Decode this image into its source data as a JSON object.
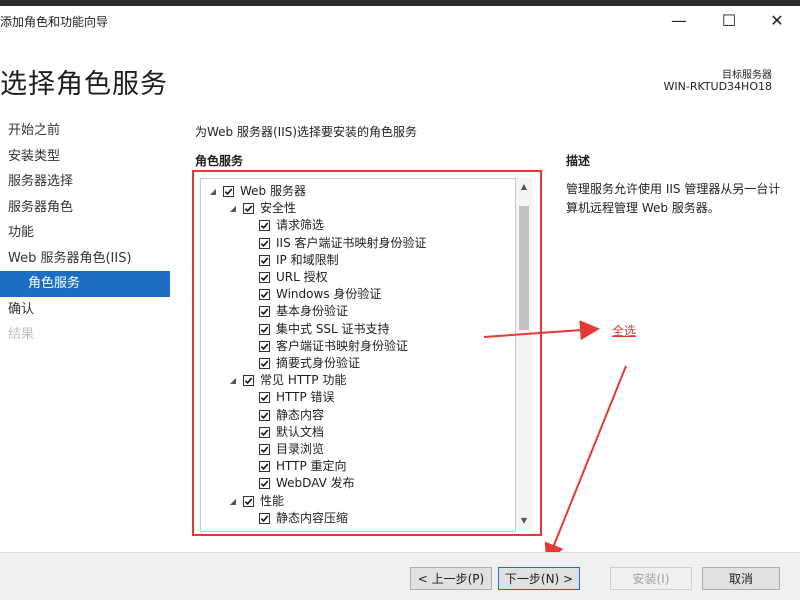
{
  "window": {
    "title": "添加角色和功能向导",
    "controls": {
      "minimize": "—",
      "maximize": "☐",
      "close": "✕"
    }
  },
  "header": {
    "page_title": "选择角色服务",
    "server_label": "目标服务器",
    "server_name": "WIN-RKTUD34HO18"
  },
  "nav": {
    "items": [
      {
        "label": "开始之前",
        "state": "normal"
      },
      {
        "label": "安装类型",
        "state": "normal"
      },
      {
        "label": "服务器选择",
        "state": "normal"
      },
      {
        "label": "服务器角色",
        "state": "normal"
      },
      {
        "label": "功能",
        "state": "normal"
      },
      {
        "label": "Web 服务器角色(IIS)",
        "state": "normal"
      },
      {
        "label": "角色服务",
        "state": "active"
      },
      {
        "label": "确认",
        "state": "normal"
      },
      {
        "label": "结果",
        "state": "disabled"
      }
    ]
  },
  "main": {
    "instruction": "为Web 服务器(IIS)选择要安装的角色服务",
    "section_title": "角色服务",
    "tree": [
      {
        "label": "Web 服务器",
        "level": 0,
        "expander": "◢",
        "checked": true
      },
      {
        "label": "安全性",
        "level": 1,
        "expander": "◢",
        "checked": true
      },
      {
        "label": "请求筛选",
        "level": 2,
        "checked": true
      },
      {
        "label": "IIS 客户端证书映射身份验证",
        "level": 2,
        "checked": true
      },
      {
        "label": "IP 和域限制",
        "level": 2,
        "checked": true
      },
      {
        "label": "URL 授权",
        "level": 2,
        "checked": true
      },
      {
        "label": "Windows 身份验证",
        "level": 2,
        "checked": true
      },
      {
        "label": "基本身份验证",
        "level": 2,
        "checked": true
      },
      {
        "label": "集中式 SSL 证书支持",
        "level": 2,
        "checked": true
      },
      {
        "label": "客户端证书映射身份验证",
        "level": 2,
        "checked": true
      },
      {
        "label": "摘要式身份验证",
        "level": 2,
        "checked": true
      },
      {
        "label": "常见 HTTP 功能",
        "level": 1,
        "expander": "◢",
        "checked": true
      },
      {
        "label": "HTTP 错误",
        "level": 2,
        "checked": true
      },
      {
        "label": "静态内容",
        "level": 2,
        "checked": true
      },
      {
        "label": "默认文档",
        "level": 2,
        "checked": true
      },
      {
        "label": "目录浏览",
        "level": 2,
        "checked": true
      },
      {
        "label": "HTTP 重定向",
        "level": 2,
        "checked": true
      },
      {
        "label": "WebDAV 发布",
        "level": 2,
        "checked": true
      },
      {
        "label": "性能",
        "level": 1,
        "expander": "◢",
        "checked": true
      },
      {
        "label": "静态内容压缩",
        "level": 2,
        "checked": true
      }
    ],
    "scrollbar": {
      "up": "▲",
      "down": "▼"
    }
  },
  "description": {
    "title": "描述",
    "text": "管理服务允许使用 IIS 管理器从另一台计算机远程管理 Web 服务器。"
  },
  "annotation": {
    "label": "全选",
    "color": "#e53935"
  },
  "footer": {
    "prev": "< 上一步(P)",
    "next": "下一步(N) >",
    "install": "安装(I)",
    "cancel": "取消"
  },
  "colors": {
    "accent": "#1c6ec5",
    "annotation_red": "#e53935"
  }
}
